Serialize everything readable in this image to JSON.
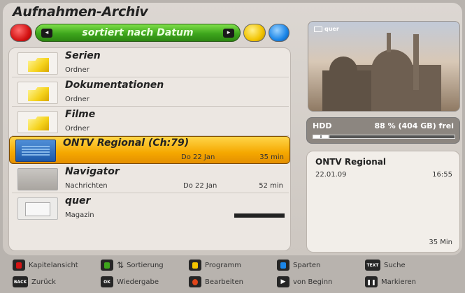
{
  "title": "Aufnahmen-Archiv",
  "colorbar": {
    "sort_label": "sortiert nach Datum",
    "left_arrow": "◂",
    "right_arrow": "▸"
  },
  "list": [
    {
      "name": "Serien",
      "sub": "Ordner",
      "date": "",
      "duration": "",
      "thumb": "folder-icon"
    },
    {
      "name": "Dokumentationen",
      "sub": "Ordner",
      "date": "",
      "duration": "",
      "thumb": "folder-icon"
    },
    {
      "name": "Filme",
      "sub": "Ordner",
      "date": "",
      "duration": "",
      "thumb": "folder-icon"
    },
    {
      "name": "ONTV Regional (Ch:79)",
      "sub": "",
      "date": "Do 22 Jan",
      "duration": "35 min",
      "thumb": "recording-thumbnail",
      "selected": true
    },
    {
      "name": "Navigator",
      "sub": "Nachrichten",
      "date": "Do 22 Jan",
      "duration": "52 min",
      "thumb": "recording-thumbnail"
    },
    {
      "name": "quer",
      "sub": "Magazin",
      "date": "",
      "duration": "",
      "thumb": "recording-thumbnail"
    }
  ],
  "preview": {
    "label": "quer"
  },
  "hdd": {
    "label": "HDD",
    "value": "88 % (404 GB) frei",
    "used_fraction": 0.12
  },
  "info": {
    "title": "ONTV Regional",
    "date": "22.01.09",
    "time": "16:55",
    "duration": "35 Min"
  },
  "legend": {
    "kapitel": "Kapitelansicht",
    "sortierung": "Sortierung",
    "programm": "Programm",
    "sparten": "Sparten",
    "suche": "Suche",
    "text_key": "TEXT",
    "zurueck": "Zurück",
    "back_key": "BACK",
    "wiedergabe": "Wiedergabe",
    "ok_key": "OK",
    "bearbeiten": "Bearbeiten",
    "von_beginn": "von Beginn",
    "markieren": "Markieren"
  },
  "colors": {
    "red": "#d41414",
    "green": "#3ea61c",
    "yellow": "#f2c400",
    "blue": "#1b86e8",
    "selection": "#f5a800"
  }
}
